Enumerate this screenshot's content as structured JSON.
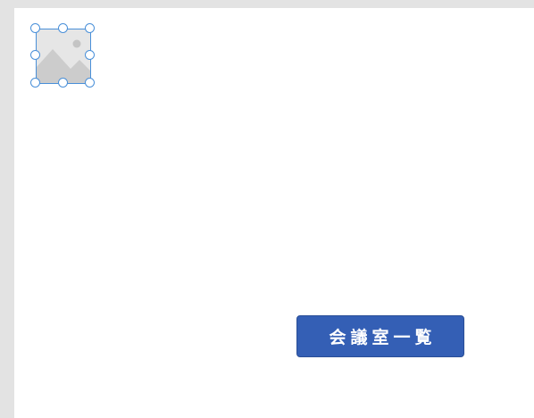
{
  "image_placeholder": {
    "icon": "image-placeholder-icon",
    "selected": true
  },
  "colors": {
    "canvas_background": "#e3e3e3",
    "slide_background": "#ffffff",
    "selection_border": "#4a90d9",
    "button_background": "#345fb5",
    "button_text": "#ffffff"
  },
  "button": {
    "label": "会議室一覧"
  }
}
